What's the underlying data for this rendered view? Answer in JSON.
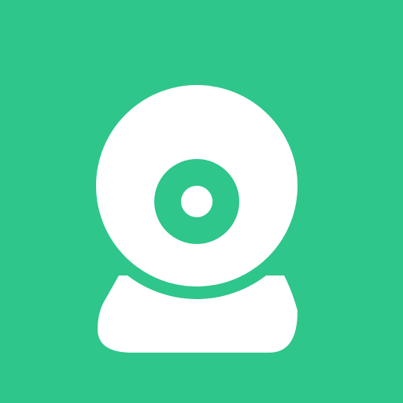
{
  "icon": {
    "name": "webcam-icon",
    "colors": {
      "background": "#2ec68a",
      "foreground": "#ffffff",
      "accent": "#2ec68a"
    }
  }
}
